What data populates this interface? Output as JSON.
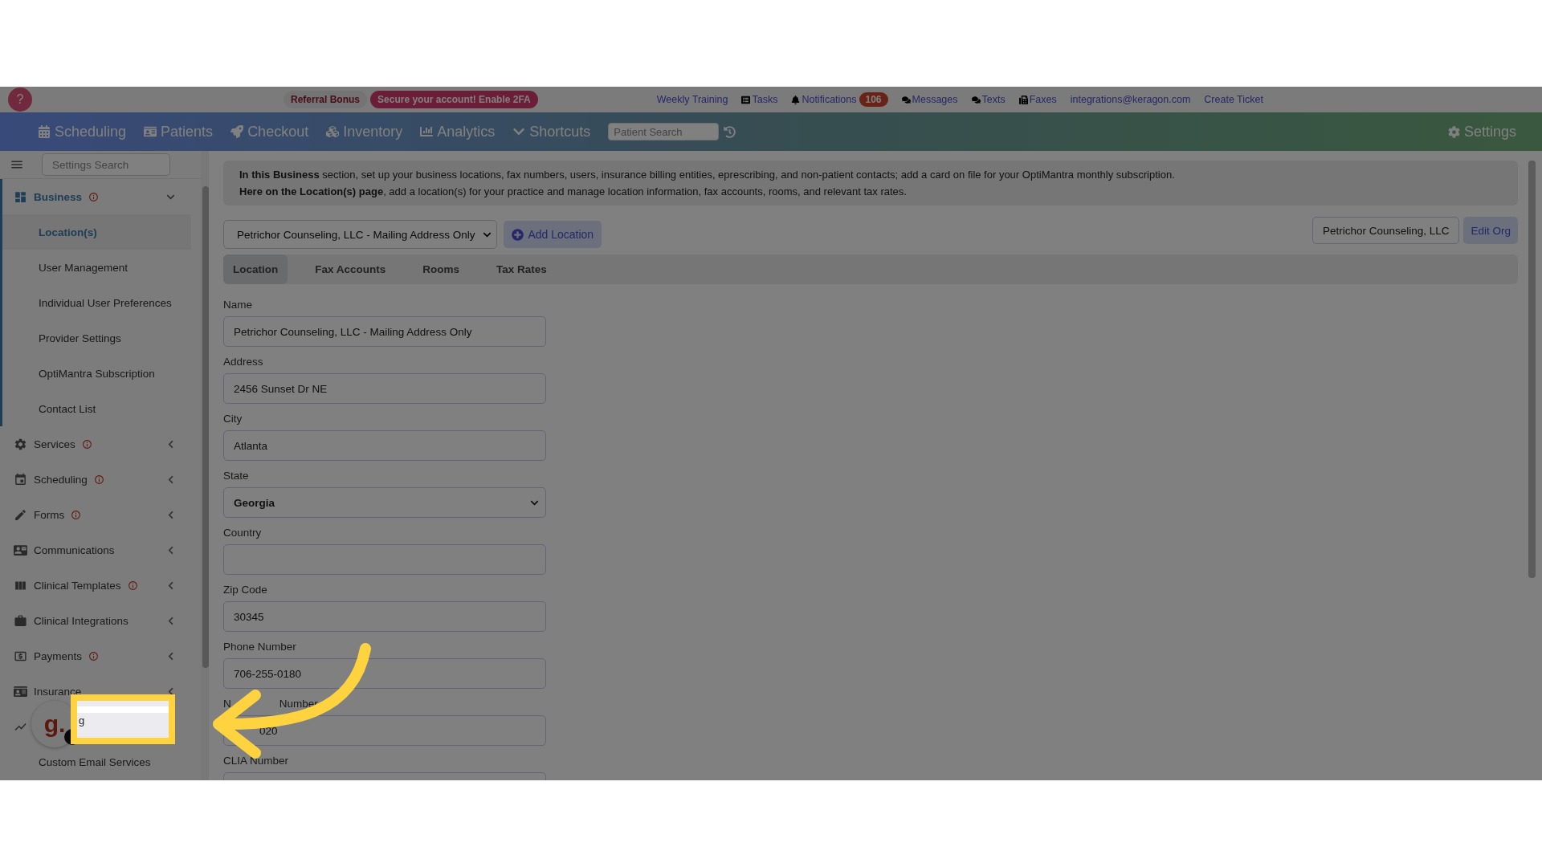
{
  "top_bar": {
    "help": "?",
    "referral": "Referral Bonus",
    "security": "Secure your account! Enable 2FA",
    "links": [
      {
        "kind": "plain",
        "label": "Weekly Training"
      },
      {
        "kind": "tasks",
        "label": "Tasks"
      },
      {
        "kind": "bell",
        "label": "Notifications",
        "badge": "106"
      },
      {
        "kind": "chat",
        "label": "Messages"
      },
      {
        "kind": "chat",
        "label": "Texts"
      },
      {
        "kind": "fax",
        "label": "Faxes"
      },
      {
        "kind": "plain",
        "label": "integrations@keragon.com"
      },
      {
        "kind": "plain",
        "label": "Create Ticket"
      }
    ]
  },
  "nav": {
    "items": [
      {
        "label": "Scheduling"
      },
      {
        "label": "Patients"
      },
      {
        "label": "Checkout"
      },
      {
        "label": "Inventory"
      },
      {
        "label": "Analytics"
      },
      {
        "label": "Shortcuts"
      }
    ],
    "search": {
      "placeholder": "Patient Search"
    },
    "settings": "Settings"
  },
  "sidebar": {
    "search": {
      "placeholder": "Settings Search"
    },
    "sections": [
      {
        "label": "Business",
        "info": true,
        "expanded": true,
        "children": [
          {
            "label": "Location(s)",
            "selected": true
          },
          {
            "label": "User Management",
            "selected": false
          },
          {
            "label": "Individual User Preferences",
            "selected": false
          },
          {
            "label": "Provider Settings",
            "selected": false
          },
          {
            "label": "OptiMantra Subscription",
            "selected": false
          },
          {
            "label": "Contact List",
            "selected": false
          }
        ]
      },
      {
        "label": "Services",
        "info": true,
        "expanded": false
      },
      {
        "label": "Scheduling",
        "info": true,
        "expanded": false
      },
      {
        "label": "Forms",
        "info": true,
        "expanded": false
      },
      {
        "label": "Communications",
        "info": false,
        "expanded": false
      },
      {
        "label": "Clinical Templates",
        "info": true,
        "expanded": false
      },
      {
        "label": "Clinical Integrations",
        "info": false,
        "expanded": false
      },
      {
        "label": "Payments",
        "info": true,
        "expanded": false
      },
      {
        "label": "Insurance",
        "info": false,
        "expanded": false
      },
      {
        "children": [
          {
            "label": "Custom Email Services",
            "selected": false
          }
        ]
      }
    ]
  },
  "chat_widget": {
    "logo": "g.",
    "popup_text": "g"
  },
  "content": {
    "info_lines": [
      "**In this Business** section, set up your business locations, fax numbers, users, insurance billing entities, eprescribing, and non-patient contacts; add a card on file for your OptiMantra monthly subscription.",
      "**Here on the Location(s) page**, add a location(s) for your practice and manage location information, fax accounts, rooms, and relevant tax rates."
    ],
    "location_select": "Petrichor Counseling, LLC - Mailing Address Only",
    "add_location": "Add Location",
    "org": "Petrichor Counseling, LLC",
    "edit_org": "Edit Org",
    "tabs": [
      {
        "label": "Location",
        "selected": true
      },
      {
        "label": "Fax Accounts",
        "selected": false
      },
      {
        "label": "Rooms",
        "selected": false
      },
      {
        "label": "Tax Rates",
        "selected": false
      }
    ],
    "fields": [
      {
        "kind": "text",
        "label": "Name",
        "value": "Petrichor Counseling, LLC - Mailing Address Only"
      },
      {
        "kind": "text",
        "label": "Address",
        "value": "2456 Sunset Dr NE"
      },
      {
        "kind": "text",
        "label": "City",
        "value": "Atlanta"
      },
      {
        "kind": "select",
        "label": "State",
        "value": "Georgia"
      },
      {
        "kind": "text",
        "label": "Country"
      },
      {
        "kind": "text",
        "label": "Zip Code",
        "value": "30345"
      },
      {
        "kind": "text",
        "label": "Phone Number",
        "value": "706-255-0180"
      },
      {
        "kind": "covered",
        "label": "N",
        "label_rest": "Number",
        "value": "020"
      },
      {
        "kind": "text",
        "label": "CLIA Number"
      }
    ]
  }
}
